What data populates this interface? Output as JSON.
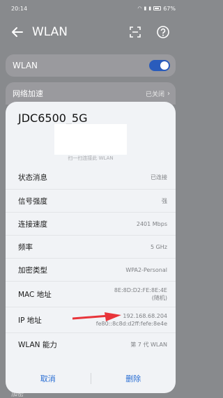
{
  "status": {
    "time": "20:14",
    "battery": "67%"
  },
  "header": {
    "title": "WLAN"
  },
  "wlan_card": {
    "label": "WLAN",
    "enabled": true
  },
  "accel_row": {
    "label": "网络加速",
    "value": "已关闭"
  },
  "bottom_hint": "加密",
  "dialog": {
    "ssid": "JDC6500_5G",
    "qr_caption": "扫一扫连接此 WLAN",
    "rows": [
      {
        "label": "状态消息",
        "value": [
          "已连接"
        ]
      },
      {
        "label": "信号强度",
        "value": [
          "强"
        ]
      },
      {
        "label": "连接速度",
        "value": [
          "2401 Mbps"
        ]
      },
      {
        "label": "频率",
        "value": [
          "5 GHz"
        ]
      },
      {
        "label": "加密类型",
        "value": [
          "WPA2-Personal"
        ]
      },
      {
        "label": "MAC 地址",
        "value": [
          "8E:8D:D2:FE:8E:4E",
          "(随机)"
        ]
      },
      {
        "label": "IP 地址",
        "value": [
          "192.168.68.204",
          "fe80::8c8d:d2ff:fefe:8e4e"
        ]
      },
      {
        "label": "WLAN 能力",
        "value": [
          "第 7 代 WLAN"
        ]
      }
    ],
    "cancel_label": "取消",
    "delete_label": "删除"
  },
  "colors": {
    "accent": "#2b6fd4",
    "arrow": "#e8343a",
    "toggle_on": "#2a5cbc"
  }
}
